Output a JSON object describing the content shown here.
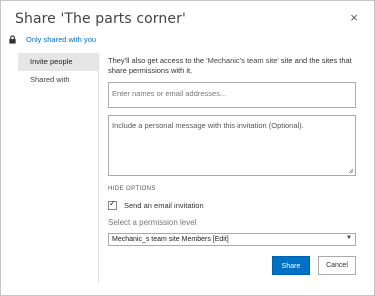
{
  "dialog": {
    "title": "Share 'The parts corner'",
    "close_glyph": "×"
  },
  "sharing": {
    "lock_icon": "lock-icon",
    "status_link": "Only shared with you"
  },
  "sidebar": {
    "items": [
      {
        "label": "Invite people",
        "active": true
      },
      {
        "label": "Shared with",
        "active": false
      }
    ]
  },
  "invite": {
    "description_prefix": "They'll also get access to the ",
    "description_site": "'Mechanic's team site'",
    "description_suffix": " site and the sites that share permissions with it.",
    "names_placeholder": "Enter names or email addresses...",
    "message_placeholder": "Include a personal message with this invitation (Optional).",
    "hide_options": "HIDE OPTIONS",
    "send_email_label": "Send an email invitation",
    "send_email_checked": true,
    "permission_label": "Select a permission level",
    "permission_value": "Mechanic_s team site Members [Edit]",
    "share_button": "Share",
    "cancel_button": "Cancel"
  },
  "colors": {
    "accent": "#0072c6",
    "border": "#ababab",
    "sidebar_active": "#e6e6e6"
  }
}
